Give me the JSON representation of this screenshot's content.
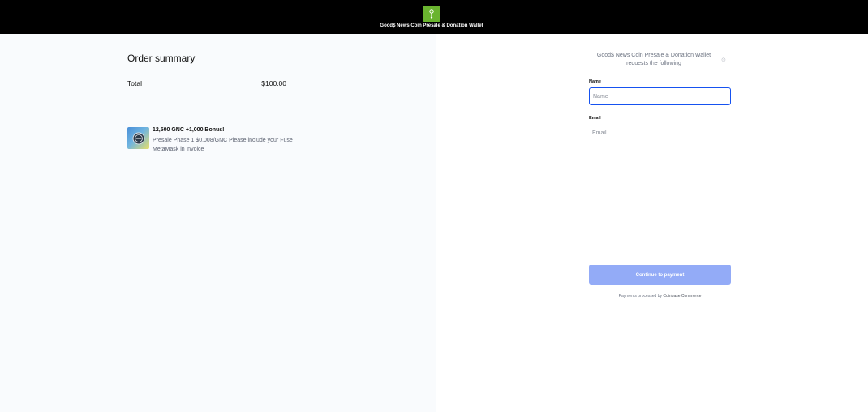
{
  "header": {
    "brand_title": "Good$ News Coin Presale & Donation Wallet",
    "logo_icon": "wallet-logo-icon",
    "logo_color": "#6ab42f"
  },
  "order": {
    "title": "Order summary",
    "total_label": "Total",
    "total_value": "$100.00",
    "item": {
      "icon": "coin-thumbnail",
      "title": "12,500 GNC +1,000 Bonus!",
      "description": "Presale Phase 1 $0.008/GNC Please include your Fuse MetaMask in invoice"
    }
  },
  "form": {
    "request_text": "Good$ News Coin Presale & Donation Wallet requests the following",
    "close_icon": "close-icon",
    "name_label": "Name",
    "name_placeholder": "Name",
    "email_label": "Email",
    "email_placeholder": "Email",
    "continue_label": "Continue to payment",
    "footer_prefix": "Payments processed by ",
    "footer_brand": "Coinbase Commerce"
  },
  "colors": {
    "accent": "#1652f0",
    "button_disabled": "#93abf7",
    "left_background": "#f9fbfd"
  }
}
